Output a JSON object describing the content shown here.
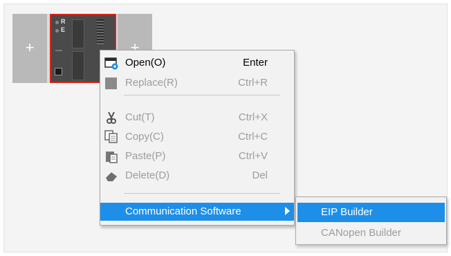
{
  "rack": {
    "left_slot_plus": "+",
    "right_slot_plus": "+",
    "cpu_led_r": "R",
    "cpu_led_e": "E"
  },
  "context_menu": {
    "items": [
      {
        "label": "Open(O)",
        "shortcut": "Enter",
        "enabled": true,
        "icon": "window-icon"
      },
      {
        "label": "Replace(R)",
        "shortcut": "Ctrl+R",
        "enabled": false,
        "icon": "replace-icon"
      },
      {
        "label": "Cut(T)",
        "shortcut": "Ctrl+X",
        "enabled": false,
        "icon": "scissors-icon"
      },
      {
        "label": "Copy(C)",
        "shortcut": "Ctrl+C",
        "enabled": false,
        "icon": "copy-icon"
      },
      {
        "label": "Paste(P)",
        "shortcut": "Ctrl+V",
        "enabled": false,
        "icon": "paste-icon"
      },
      {
        "label": "Delete(D)",
        "shortcut": "Del",
        "enabled": false,
        "icon": "eraser-icon"
      },
      {
        "label": "Communication Software",
        "shortcut": "",
        "enabled": true,
        "highlighted": true,
        "has_submenu": true
      }
    ]
  },
  "submenu": {
    "items": [
      {
        "label": "EIP Builder",
        "enabled": true,
        "highlighted": true
      },
      {
        "label": "CANopen Builder",
        "enabled": false
      }
    ]
  },
  "colors": {
    "highlight": "#1e8fe8",
    "disabled_text": "#9c9c9c",
    "cpu_border": "#d8231a"
  }
}
